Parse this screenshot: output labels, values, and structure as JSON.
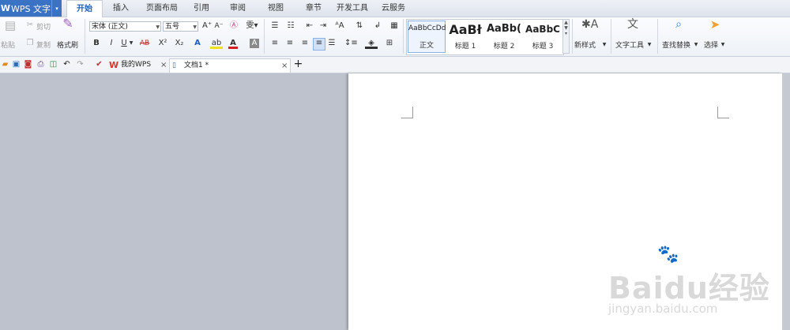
{
  "app": {
    "logo_glyph": "W",
    "name": "WPS 文字",
    "dropdown_glyph": "▾"
  },
  "menu_tabs": [
    {
      "label": "开始",
      "active": true
    },
    {
      "label": "插入"
    },
    {
      "label": "页面布局"
    },
    {
      "label": "引用"
    },
    {
      "label": "审阅"
    },
    {
      "label": "视图"
    },
    {
      "label": "章节"
    },
    {
      "label": "开发工具"
    },
    {
      "label": "云服务"
    }
  ],
  "ribbon": {
    "paste_label": "粘贴",
    "cut_label": "剪切",
    "copy_label": "复制",
    "format_painter_label": "格式刷",
    "font_name": "宋体 (正文)",
    "font_size": "五号",
    "bold": "B",
    "italic": "I",
    "underline": "U",
    "strike": "AB",
    "superscript": "X²",
    "subscript": "X₂",
    "styles": [
      {
        "preview": "AaBbCcDd",
        "name": "正文",
        "selected": true
      },
      {
        "preview": "AaBł",
        "name": "标题 1"
      },
      {
        "preview": "AaBb(",
        "name": "标题 2"
      },
      {
        "preview": "AaBbC",
        "name": "标题 3"
      }
    ],
    "new_style_label": "新样式",
    "text_tools_label": "文字工具",
    "find_replace_label": "查找替换",
    "select_label": "选择"
  },
  "doc_tabs": [
    {
      "label": "我的WPS",
      "close": "×"
    },
    {
      "label": "文档1 *",
      "close": "×"
    }
  ],
  "new_tab": "+",
  "watermark": {
    "brand": "Baidu经验",
    "url": "jingyan.baidu.com"
  },
  "colors": {
    "accent": "#3a72c4",
    "active_tab_text": "#1f5fb8",
    "wps_red": "#d9372b"
  }
}
